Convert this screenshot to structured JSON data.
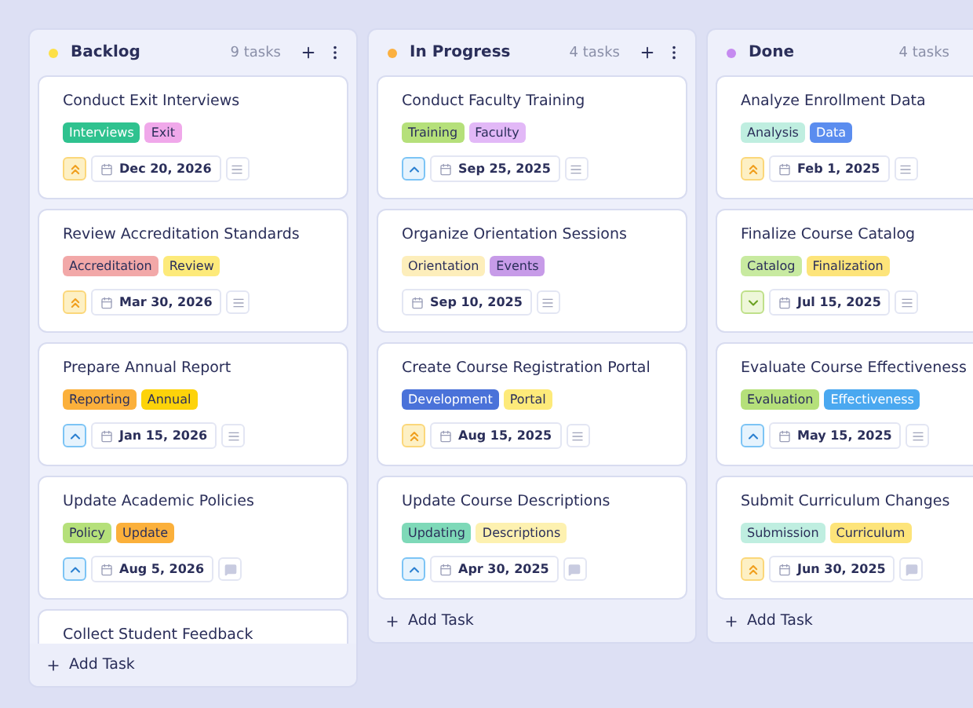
{
  "columns": [
    {
      "title": "Backlog",
      "color": "#fde047",
      "count": "9 tasks",
      "actions": true,
      "add_label": "Add Task",
      "cards": [
        {
          "title": "Conduct Exit Interviews",
          "tags": [
            {
              "label": "Interviews",
              "color": "#2fc28f"
            },
            {
              "label": "Exit",
              "color": "#f0a8ea"
            }
          ],
          "kind": "high",
          "date": "Dec 20, 2026",
          "notes": false
        },
        {
          "title": "Review Accreditation Standards",
          "tags": [
            {
              "label": "Accreditation",
              "color": "#f2a8a8"
            },
            {
              "label": "Review",
              "color": "#fdea7a"
            }
          ],
          "kind": "high",
          "date": "Mar 30, 2026",
          "notes": false
        },
        {
          "title": "Prepare Annual Report",
          "tags": [
            {
              "label": "Reporting",
              "color": "#fbb03b"
            },
            {
              "label": "Annual",
              "color": "#fdd30a"
            }
          ],
          "kind": "medium",
          "date": "Jan 15, 2026",
          "notes": false
        },
        {
          "title": "Update Academic Policies",
          "tags": [
            {
              "label": "Policy",
              "color": "#b5e07a"
            },
            {
              "label": "Update",
              "color": "#fbb03b"
            }
          ],
          "kind": "medium",
          "date": "Aug 5, 2026",
          "notes": true
        },
        {
          "title": "Collect Student Feedback"
        }
      ]
    },
    {
      "title": "In Progress",
      "color": "#fbb040",
      "count": "4 tasks",
      "actions": true,
      "add_label": "Add Task",
      "cards": [
        {
          "title": "Conduct Faculty Training",
          "tags": [
            {
              "label": "Training",
              "color": "#b5e07a"
            },
            {
              "label": "Faculty",
              "color": "#e2b8f7"
            }
          ],
          "kind": "medium",
          "date": "Sep 25, 2025",
          "notes": false
        },
        {
          "title": "Organize Orientation Sessions",
          "tags": [
            {
              "label": "Orientation",
              "color": "#fdeebb"
            },
            {
              "label": "Events",
              "color": "#c79be8"
            }
          ],
          "kind": "plain",
          "date": "Sep 10, 2025",
          "notes": false
        },
        {
          "title": "Create Course Registration Portal",
          "tags": [
            {
              "label": "Development",
              "color": "#4a72d9"
            },
            {
              "label": "Portal",
              "color": "#fdea7a"
            }
          ],
          "kind": "high",
          "date": "Aug 15, 2025",
          "notes": false
        },
        {
          "title": "Update Course Descriptions",
          "tags": [
            {
              "label": "Updating",
              "color": "#7ed9b8"
            },
            {
              "label": "Descriptions",
              "color": "#fdf1b0"
            }
          ],
          "kind": "medium",
          "date": "Apr 30, 2025",
          "notes": true
        }
      ]
    },
    {
      "title": "Done",
      "color": "#c58af0",
      "count": "4 tasks",
      "actions": false,
      "add_label": "Add Task",
      "cards": [
        {
          "title": "Analyze Enrollment Data",
          "tags": [
            {
              "label": "Analysis",
              "color": "#bfeee0"
            },
            {
              "label": "Data",
              "color": "#5b8def"
            }
          ],
          "kind": "high",
          "date": "Feb 1, 2025",
          "notes": false
        },
        {
          "title": "Finalize Course Catalog",
          "tags": [
            {
              "label": "Catalog",
              "color": "#c8eaa0"
            },
            {
              "label": "Finalization",
              "color": "#fde47a"
            }
          ],
          "kind": "low",
          "date": "Jul 15, 2025",
          "notes": false
        },
        {
          "title": "Evaluate Course Effectiveness",
          "tags": [
            {
              "label": "Evaluation",
              "color": "#b5e07a"
            },
            {
              "label": "Effectiveness",
              "color": "#4aa8f0"
            }
          ],
          "kind": "medium",
          "date": "May 15, 2025",
          "notes": false
        },
        {
          "title": "Submit Curriculum Changes",
          "tags": [
            {
              "label": "Submission",
              "color": "#bfeee0"
            },
            {
              "label": "Curriculum",
              "color": "#fde47a"
            }
          ],
          "kind": "high",
          "date": "Jun 30, 2025",
          "notes": true
        }
      ]
    }
  ]
}
